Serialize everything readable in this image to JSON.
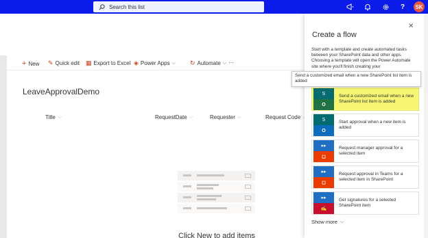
{
  "suite_bar": {
    "search_placeholder": "Search this list",
    "icons": [
      "megaphone-icon",
      "bell-icon",
      "gear-icon",
      "help-icon"
    ],
    "avatar_initials": "SK",
    "colors": {
      "bar": "#0b1cea",
      "avatar": "#e8563d"
    }
  },
  "command_bar": {
    "new": "New",
    "quick_edit": "Quick edit",
    "export": "Export to Excel",
    "power_apps": "Power Apps",
    "automate": "Automate",
    "more": "···"
  },
  "list": {
    "title": "LeaveApprovalDemo",
    "columns": [
      "Title",
      "RequestDate",
      "Requester",
      "Request Code"
    ],
    "empty_text": "Click New to add items"
  },
  "flow_panel": {
    "title": "Create a flow",
    "description": "Start with a template and create automated tasks between your SharePoint data and other apps. Choosing a template will open the Power Automate site where you'll finish creating your",
    "tooltip": "Send a customized email when a new SharePoint list item is added",
    "templates": [
      {
        "label": "Send a customized email when a new SharePoint list item is added",
        "highlighted": true,
        "icon_top": "sharepoint-icon",
        "icon_bottom": "outlook-icon"
      },
      {
        "label": "Start approval when a new item is added",
        "highlighted": false,
        "icon_top": "sharepoint-icon",
        "icon_bottom": "outlook-icon"
      },
      {
        "label": "Request manager approval for a selected item",
        "highlighted": false,
        "icon_top": "flow-icon",
        "icon_bottom": "office-icon"
      },
      {
        "label": "Request approval in Teams for a selected item in SharePoint",
        "highlighted": false,
        "icon_top": "flow-icon",
        "icon_bottom": "office-icon"
      },
      {
        "label": "Get signatures for a selected SharePoint item",
        "highlighted": false,
        "icon_top": "flow-icon",
        "icon_bottom": "adobe-sign-icon"
      }
    ],
    "show_more": "Show more",
    "highlight_color": "#f7f774"
  }
}
